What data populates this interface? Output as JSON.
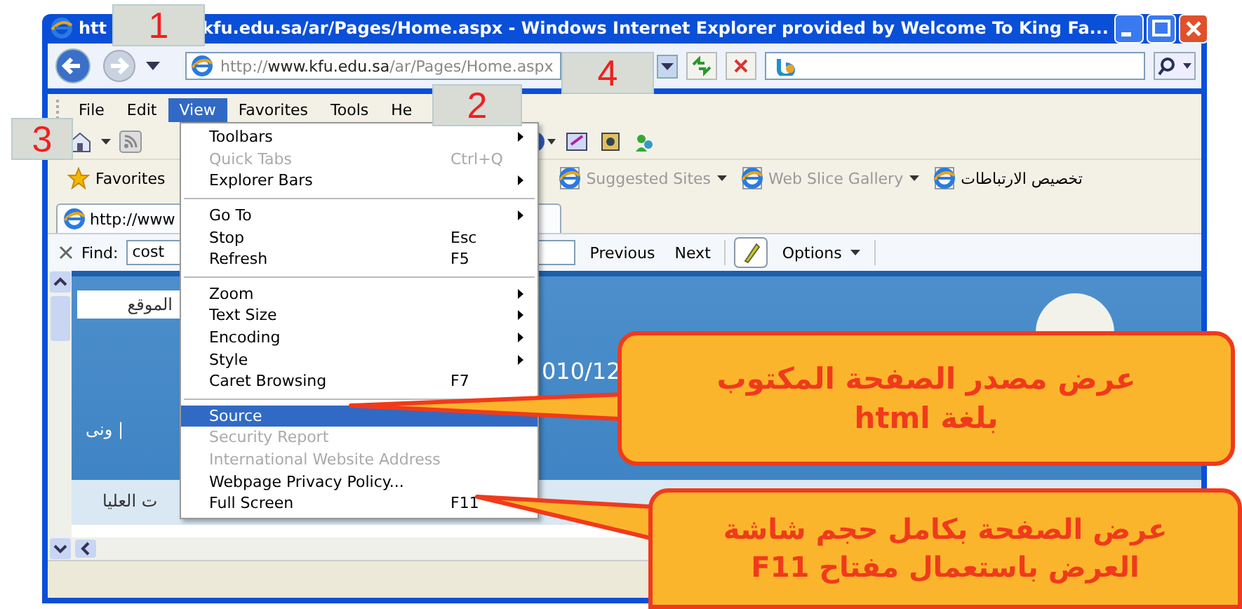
{
  "window": {
    "title_parts": [
      "htt",
      "kfu.edu.sa/ar/Pages/Home.aspx - Windows Internet Explorer provided by Welcome To King Fa..."
    ]
  },
  "address": {
    "prefix": "http://",
    "domain": "www.kfu.edu.sa",
    "path": "/ar/Pages/Home.aspx"
  },
  "menu_bar": [
    {
      "label": "File",
      "selected": false
    },
    {
      "label": "Edit",
      "selected": false
    },
    {
      "label": "View",
      "selected": true
    },
    {
      "label": "Favorites",
      "selected": false
    },
    {
      "label": "Tools",
      "selected": false
    },
    {
      "label": "He",
      "selected": false
    }
  ],
  "favorites_bar": [
    {
      "label": "Favorites",
      "kind": "star"
    },
    {
      "label": "Suggested Sites",
      "kind": "dropdown"
    },
    {
      "label": "Web Slice Gallery",
      "kind": "dropdown"
    },
    {
      "label": "تخصيص الارتباطات",
      "kind": "link"
    }
  ],
  "tab": {
    "label": "http://www"
  },
  "find_bar": {
    "label": "Find:",
    "value": "cost",
    "buttons": [
      "Previous",
      "Next"
    ],
    "options": "Options"
  },
  "page": {
    "texts": [
      "الموقع",
      "010/12",
      "ونى |",
      "ت العليا"
    ]
  },
  "view_menu": [
    {
      "kind": "item",
      "label": "Toolbars",
      "submenu": true,
      "disabled": false,
      "selected": false
    },
    {
      "kind": "item",
      "label": "Quick Tabs",
      "shortcut": "Ctrl+Q",
      "submenu": false,
      "disabled": true,
      "selected": false
    },
    {
      "kind": "item",
      "label": "Explorer Bars",
      "submenu": true,
      "disabled": false,
      "selected": false
    },
    {
      "kind": "separator"
    },
    {
      "kind": "item",
      "label": "Go To",
      "submenu": true,
      "disabled": false,
      "selected": false
    },
    {
      "kind": "item",
      "label": "Stop",
      "shortcut": "Esc",
      "submenu": false,
      "disabled": false,
      "selected": false
    },
    {
      "kind": "item",
      "label": "Refresh",
      "shortcut": "F5",
      "submenu": false,
      "disabled": false,
      "selected": false
    },
    {
      "kind": "separator"
    },
    {
      "kind": "item",
      "label": "Zoom",
      "submenu": true,
      "disabled": false,
      "selected": false
    },
    {
      "kind": "item",
      "label": "Text Size",
      "submenu": true,
      "disabled": false,
      "selected": false
    },
    {
      "kind": "item",
      "label": "Encoding",
      "submenu": true,
      "disabled": false,
      "selected": false
    },
    {
      "kind": "item",
      "label": "Style",
      "submenu": true,
      "disabled": false,
      "selected": false
    },
    {
      "kind": "item",
      "label": "Caret Browsing",
      "shortcut": "F7",
      "submenu": false,
      "disabled": false,
      "selected": false
    },
    {
      "kind": "separator"
    },
    {
      "kind": "item",
      "label": "Source",
      "submenu": false,
      "disabled": false,
      "selected": true
    },
    {
      "kind": "item",
      "label": "Security Report",
      "submenu": false,
      "disabled": true,
      "selected": false
    },
    {
      "kind": "item",
      "label": "International Website Address",
      "submenu": false,
      "disabled": true,
      "selected": false
    },
    {
      "kind": "item",
      "label": "Webpage Privacy Policy...",
      "submenu": false,
      "disabled": false,
      "selected": false
    },
    {
      "kind": "item",
      "label": "Full Screen",
      "shortcut": "F11",
      "submenu": false,
      "disabled": false,
      "selected": false
    }
  ],
  "number_labels": [
    "1",
    "2",
    "3",
    "4"
  ],
  "callouts": [
    {
      "lines": [
        "عرض مصدر الصفحة المكتوب",
        "بلغة html"
      ]
    },
    {
      "lines": [
        "عرض الصفحة بكامل حجم شاشة",
        "العرض باستعمال مفتاح F11"
      ]
    }
  ]
}
